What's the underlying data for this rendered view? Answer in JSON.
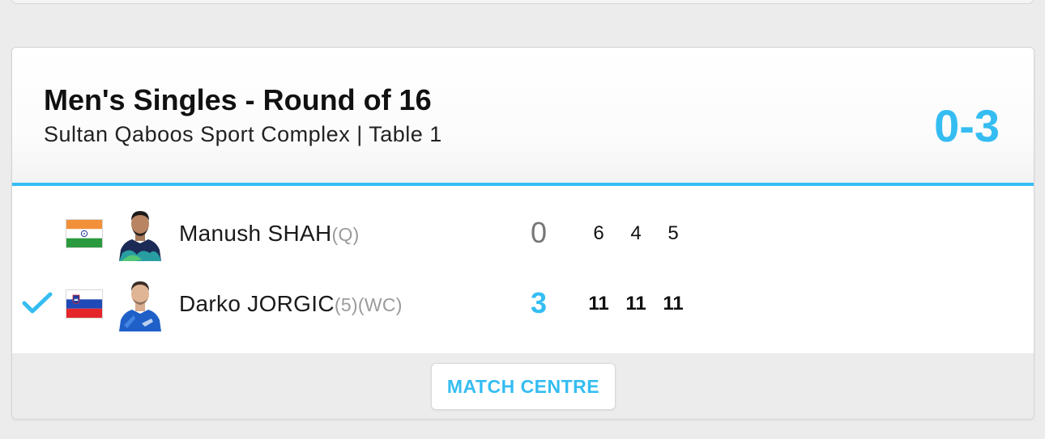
{
  "match": {
    "title": "Men's Singles - Round of 16",
    "venue": "Sultan Qaboos Sport Complex | Table 1",
    "overall_score": "0-3"
  },
  "players": [
    {
      "name": "Manush SHAH",
      "seed": "",
      "tag": "(Q)",
      "country_flag": "india-flag",
      "match_score": "0",
      "games": [
        "6",
        "4",
        "5"
      ],
      "winner": false
    },
    {
      "name": "Darko JORGIC",
      "seed": "(5)",
      "tag": "(WC)",
      "country_flag": "slovenia-flag",
      "match_score": "3",
      "games": [
        "11",
        "11",
        "11"
      ],
      "winner": true
    }
  ],
  "footer": {
    "match_centre_label": "MATCH CENTRE"
  },
  "colors": {
    "accent": "#35bdf2",
    "loser_score": "#777777",
    "footer_bg": "#ececec"
  }
}
